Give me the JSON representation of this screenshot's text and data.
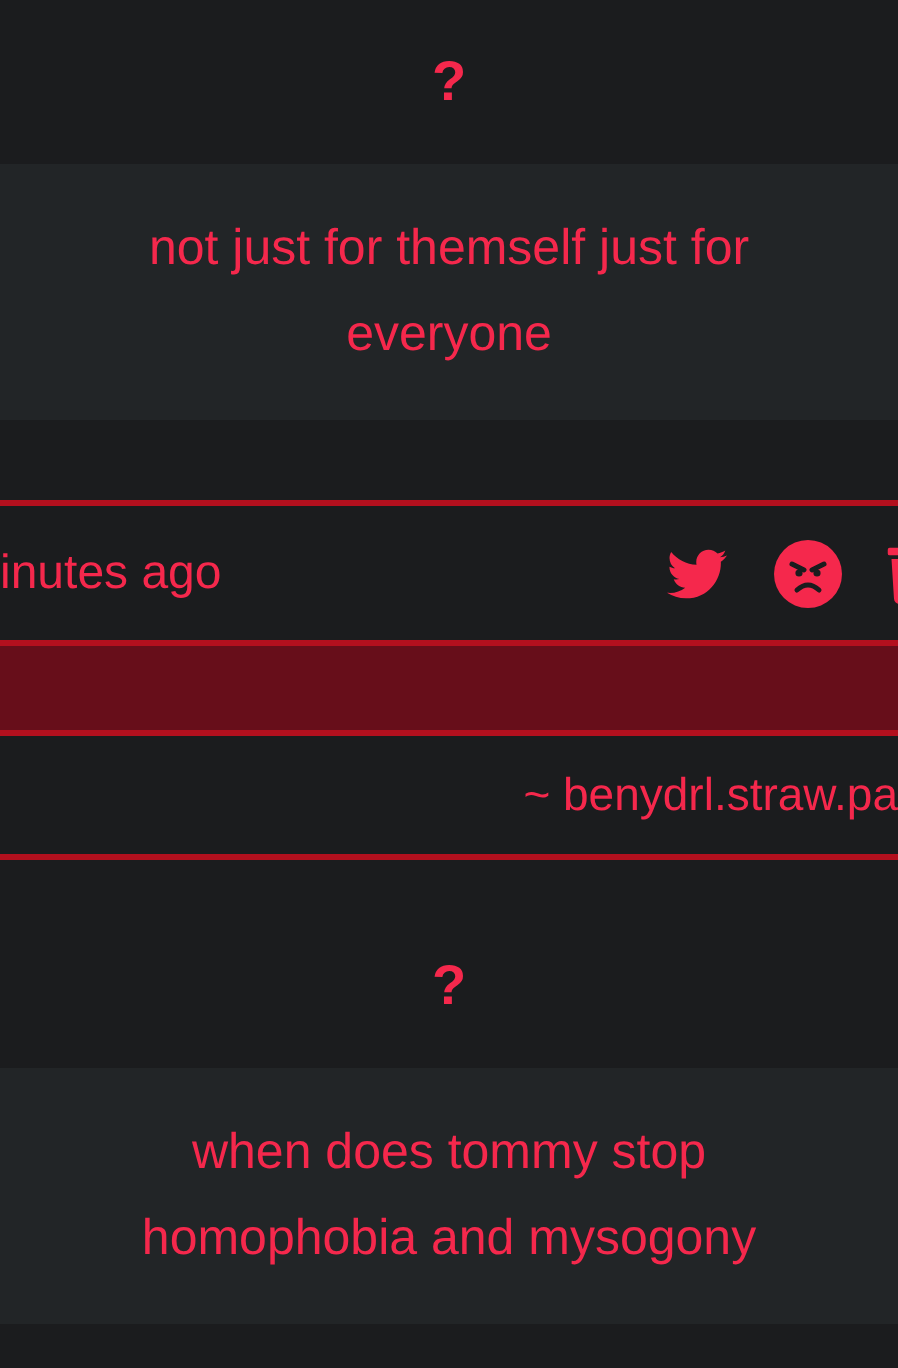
{
  "items": [
    {
      "kind": "answer",
      "question": "?",
      "answer": "not just for themself just for everyone"
    },
    {
      "kind": "card",
      "time": "inutes ago",
      "author": "~ benydrl.straw.pa"
    },
    {
      "kind": "answer",
      "question": "?",
      "answer": "when does tommy stop homophobia and mysogony"
    }
  ]
}
